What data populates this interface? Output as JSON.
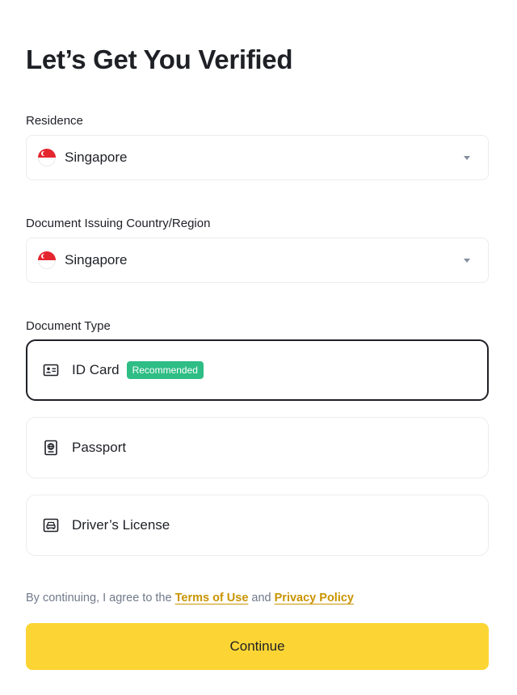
{
  "page": {
    "title": "Let’s Get You Verified"
  },
  "residence": {
    "label": "Residence",
    "value": "Singapore",
    "flag_icon": "singapore-flag-icon"
  },
  "issuing_country": {
    "label": "Document Issuing Country/Region",
    "value": "Singapore",
    "flag_icon": "singapore-flag-icon"
  },
  "document_type": {
    "label": "Document Type",
    "options": [
      {
        "label": "ID Card",
        "icon": "id-card-icon",
        "badge": "Recommended",
        "selected": true
      },
      {
        "label": "Passport",
        "icon": "passport-icon",
        "selected": false
      },
      {
        "label": "Driver’s License",
        "icon": "drivers-license-icon",
        "selected": false
      }
    ]
  },
  "consent": {
    "prefix": "By continuing, I agree to the ",
    "terms_link": "Terms of Use",
    "middle": " and ",
    "privacy_link": "Privacy Policy"
  },
  "actions": {
    "continue_label": "Continue"
  },
  "colors": {
    "accent_yellow": "#fcd535",
    "link": "#c99400",
    "badge_green": "#2ebd85",
    "text": "#1e2026",
    "muted": "#707a8a",
    "border": "#eaecef"
  }
}
